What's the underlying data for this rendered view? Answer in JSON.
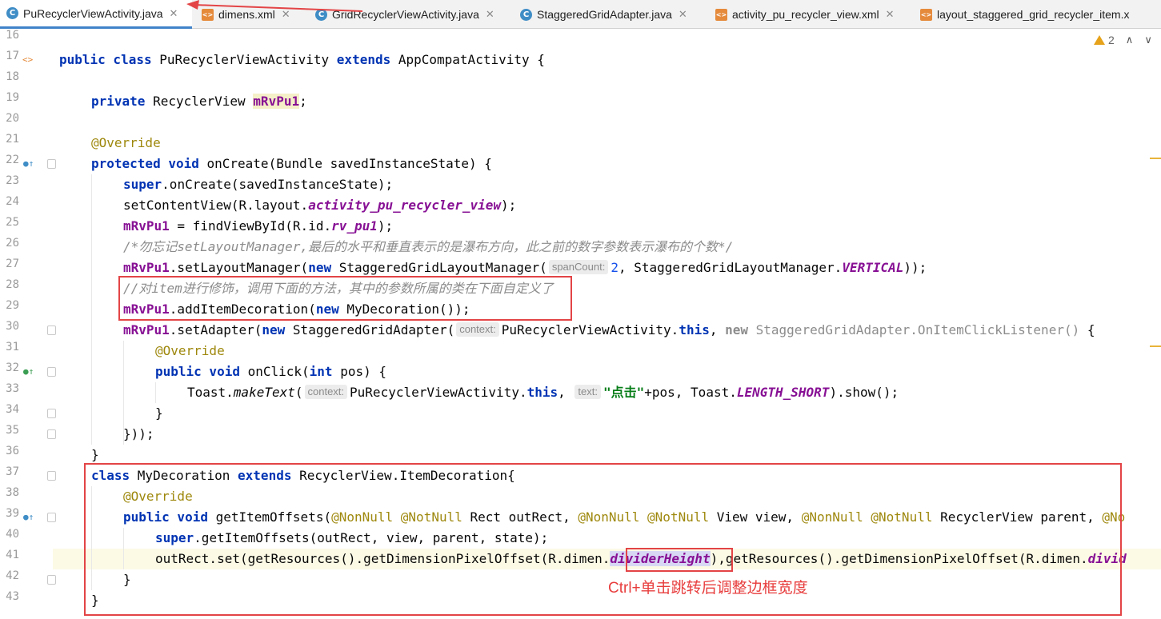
{
  "tabs": [
    {
      "label": "PuRecyclerViewActivity.java",
      "icon": "java-class-icon",
      "active": true
    },
    {
      "label": "dimens.xml",
      "icon": "xml-file-icon",
      "active": false
    },
    {
      "label": "GridRecyclerViewActivity.java",
      "icon": "java-class-icon",
      "active": false
    },
    {
      "label": "StaggeredGridAdapter.java",
      "icon": "java-class-icon",
      "active": false
    },
    {
      "label": "activity_pu_recycler_view.xml",
      "icon": "xml-file-icon",
      "active": false
    },
    {
      "label": "layout_staggered_grid_recycler_item.x",
      "icon": "xml-file-icon",
      "active": false
    }
  ],
  "close_glyph": "✕",
  "java_glyph": "C",
  "xml_glyph": "<>",
  "warnings": {
    "count": "2",
    "up": "∧",
    "down": "∨"
  },
  "line_numbers": [
    "16",
    "17",
    "18",
    "19",
    "20",
    "21",
    "22",
    "23",
    "24",
    "25",
    "26",
    "27",
    "28",
    "29",
    "30",
    "31",
    "32",
    "33",
    "34",
    "35",
    "36",
    "37",
    "38",
    "39",
    "40",
    "41",
    "42",
    "43"
  ],
  "gutter_marks": {
    "override_glyph": "●↑"
  },
  "code": {
    "l17": {
      "kw1": "public class ",
      "name": "PuRecyclerViewActivity ",
      "kw2": "extends ",
      "rest": "AppCompatActivity {"
    },
    "l19": {
      "kw": "private ",
      "type": "RecyclerView ",
      "field": "mRvPu1",
      "rest": ";"
    },
    "l21": {
      "ann": "@Override"
    },
    "l22": {
      "kw1": "protected void ",
      "rest": "onCreate(Bundle savedInstanceState) {"
    },
    "l23": {
      "kw": "super",
      "rest": ".onCreate(savedInstanceState);"
    },
    "l24": {
      "a": "setContentView(R.layout.",
      "field": "activity_pu_recycler_view",
      "b": ");"
    },
    "l25": {
      "field": "mRvPu1",
      "a": " = findViewById(R.id.",
      "field2": "rv_pu1",
      "b": ");"
    },
    "l26": {
      "comment": "/*勿忘记setLayoutManager,最后的水平和垂直表示的是瀑布方向，此之前的数字参数表示瀑布的个数*/"
    },
    "l27": {
      "field": "mRvPu1",
      "a": ".setLayoutManager(",
      "kw": "new ",
      "b": "StaggeredGridLayoutManager(",
      "hint": "spanCount:",
      "num": "2",
      "c": ", StaggeredGridLayoutManager.",
      "field2": "VERTICAL",
      "d": "));"
    },
    "l28": {
      "comment": "//对item进行修饰，调用下面的方法，其中的参数所属的类在下面自定义了"
    },
    "l29": {
      "field": "mRvPu1",
      "a": ".addItemDecoration(",
      "kw": "new ",
      "b": "MyDecoration());"
    },
    "l30": {
      "field": "mRvPu1",
      "a": ".setAdapter(",
      "kw": "new ",
      "b": "StaggeredGridAdapter(",
      "hint": "context:",
      "c": "PuRecyclerViewActivity.",
      "kw2": "this",
      "d": ", ",
      "kw3": "new ",
      "gray": "StaggeredGridAdapter.OnItemClickListener()",
      "e": " {"
    },
    "l31": {
      "ann": "@Override"
    },
    "l32": {
      "kw1": "public void ",
      "a": "onClick(",
      "kw2": "int ",
      "b": "pos) {"
    },
    "l33": {
      "a": "Toast.",
      "m": "makeText",
      "b": "(",
      "hint": "context:",
      "c": "PuRecyclerViewActivity.",
      "kw": "this",
      "d": ", ",
      "hint2": "text:",
      "str": "\"点击\"",
      "e": "+pos, Toast.",
      "field": "LENGTH_SHORT",
      "f": ").show();"
    },
    "l34": {
      "a": "}"
    },
    "l35": {
      "a": "}));"
    },
    "l36": {
      "a": "}"
    },
    "l37": {
      "kw": "class ",
      "a": "MyDecoration ",
      "kw2": "extends ",
      "b": "RecyclerView.ItemDecoration{"
    },
    "l38": {
      "ann": "@Override"
    },
    "l39": {
      "kw": "public void ",
      "a": "getItemOffsets(",
      "ann1": "@NonNull @NotNull ",
      "b": "Rect outRect, ",
      "ann2": "@NonNull @NotNull ",
      "c": "View view, ",
      "ann3": "@NonNull @NotNull ",
      "d": "RecyclerView parent, ",
      "ann4": "@No"
    },
    "l40": {
      "kw": "super",
      "a": ".getItemOffsets(outRect, view, parent, state);"
    },
    "l41": {
      "a": "outRect.set(getResources().getDimensionPixelOffset(R.dimen.",
      "field": "dividerHeight",
      "b": "),getResources().getDimensionPixelOffset(R.dimen.",
      "field2": "divid"
    },
    "l42": {
      "a": "}"
    },
    "l43": {
      "a": "}"
    }
  },
  "annotation_note": "Ctrl+单击跳转后调整边框宽度",
  "colors": {
    "annotation_red": "#e34446",
    "keyword": "#0033b3",
    "field": "#871094",
    "comment": "#8c8c8c",
    "active_tab_underline": "#4083c9"
  }
}
